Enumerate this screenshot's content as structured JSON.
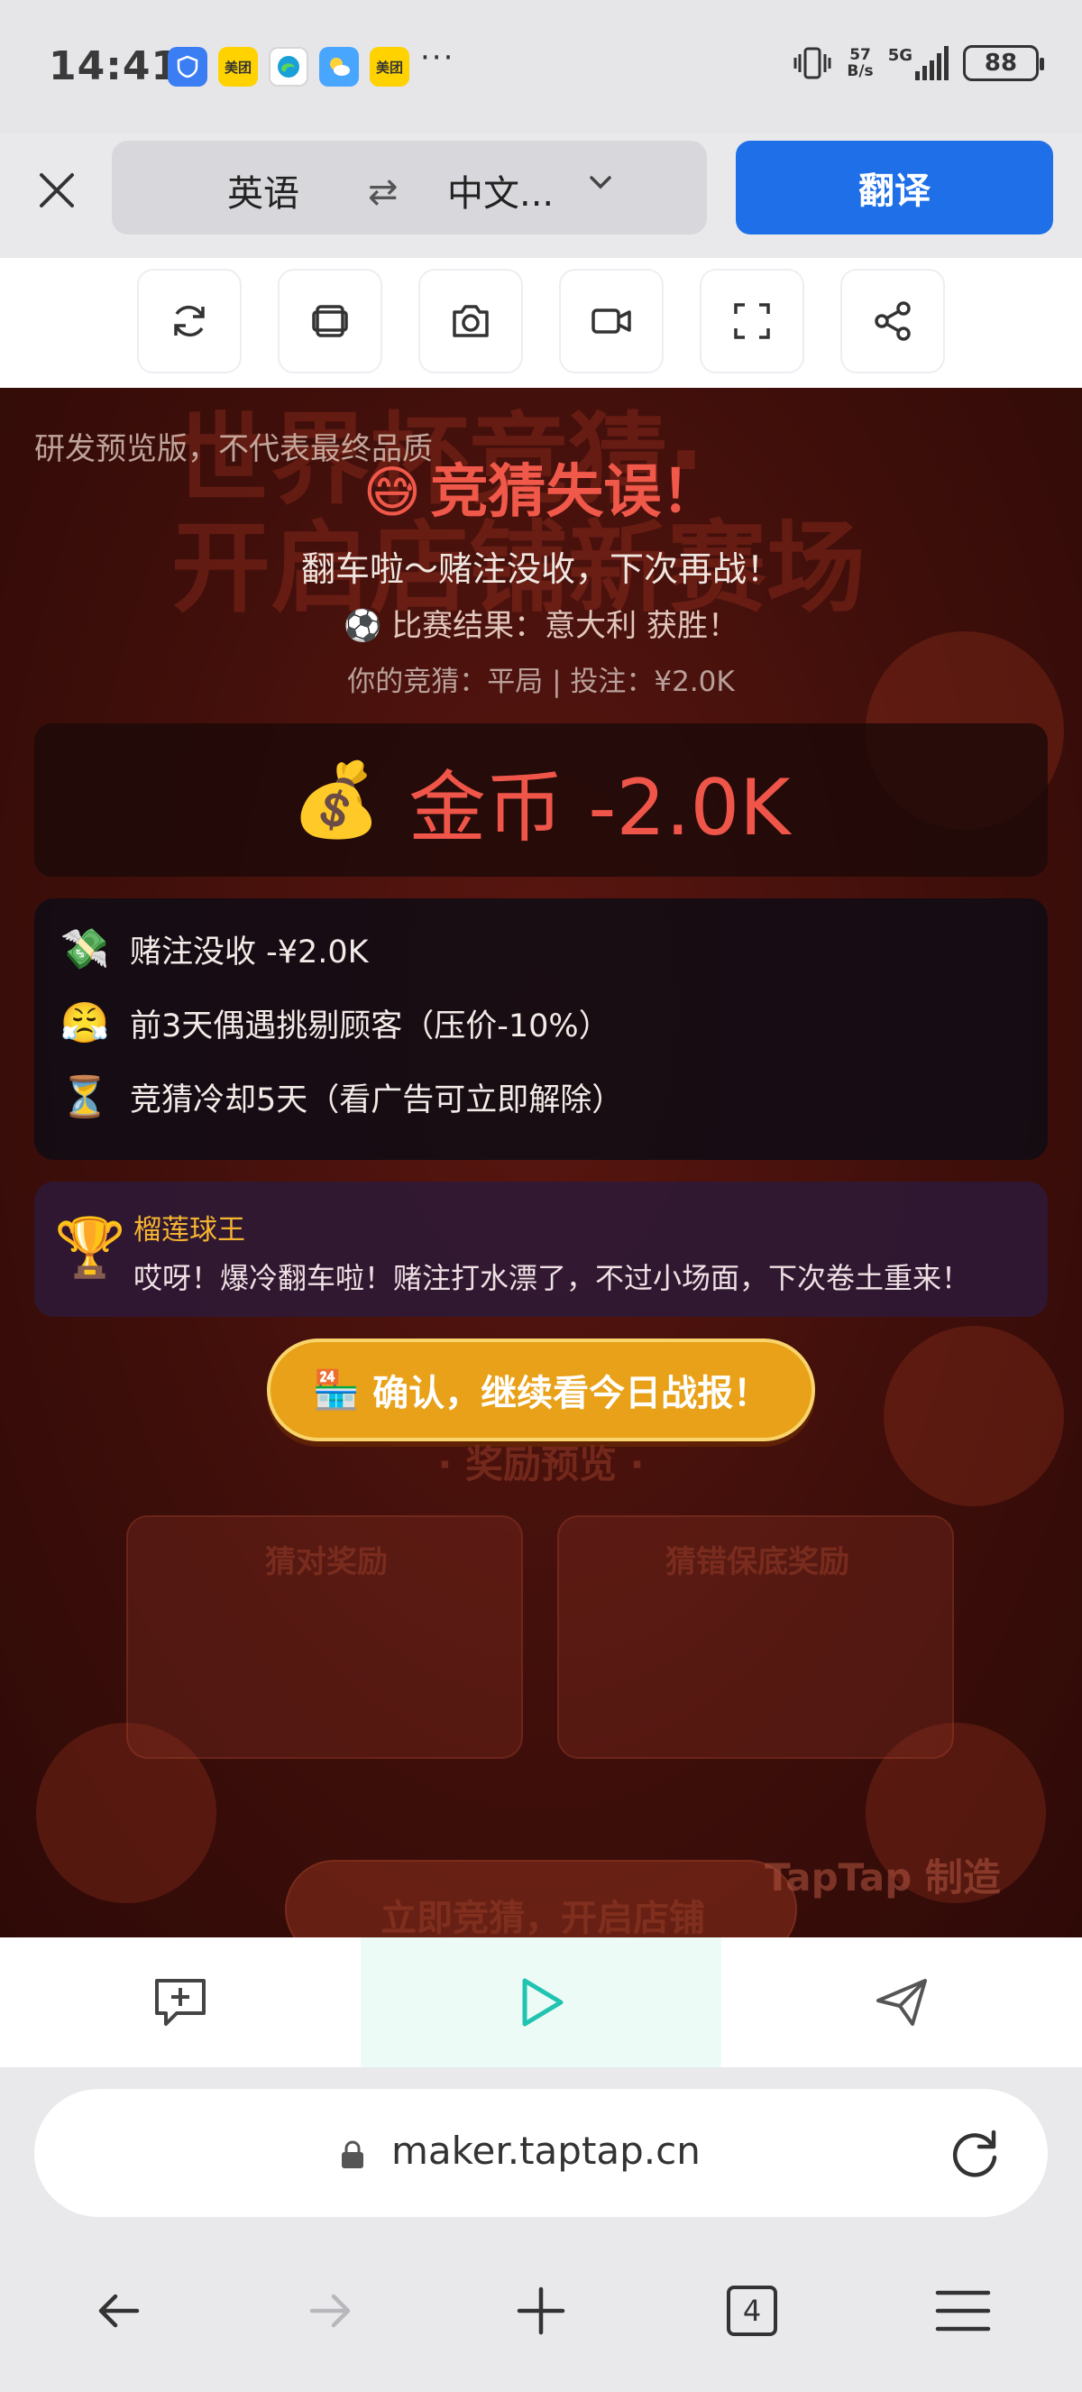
{
  "status_bar": {
    "time": "14:41",
    "apps": [
      {
        "name": "security-app-icon",
        "label": "",
        "style": "app-blue"
      },
      {
        "name": "meituan-app-icon",
        "label": "美团",
        "style": "app-yellow"
      },
      {
        "name": "edge-app-icon",
        "label": "",
        "style": "app-edge"
      },
      {
        "name": "weather-app-icon",
        "label": "",
        "style": "app-weather"
      },
      {
        "name": "meituan-app-icon-2",
        "label": "美团",
        "style": "app-yellow"
      }
    ],
    "more": "···",
    "net_speed_value": "57",
    "net_speed_unit": "B/s",
    "network": "5G",
    "battery": "88"
  },
  "translate_bar": {
    "source_lang": "英语",
    "swap_symbol": "⇄",
    "target_lang": "中文...",
    "translate_label": "翻译"
  },
  "toolbar": {
    "icons": [
      "refresh-icon",
      "copy-icon",
      "camera-icon",
      "video-icon",
      "fullscreen-icon",
      "share-icon"
    ]
  },
  "game": {
    "watermark": "研发预览版，不代表最终品质",
    "title_emoji": "😅",
    "title": "竞猜失误！",
    "subtitle": "翻车啦～赌注没收，下次再战！",
    "result_emoji": "⚽",
    "result": "比赛结果：意大利 获胜！",
    "guess": "你的竞猜：平局 | 投注：¥2.0K",
    "coin_emoji": "💰",
    "coin_change": "金币 -2.0K",
    "details": [
      {
        "emoji": "💸",
        "text": "赌注没收 -¥2.0K"
      },
      {
        "emoji": "😤",
        "text": "前3天偶遇挑剔顾客（压价-10%）"
      },
      {
        "emoji": "⏳",
        "text": "竞猜冷却5天（看广告可立即解除）"
      }
    ],
    "npc_emoji": "🏆",
    "npc_name": "榴莲球王",
    "npc_say": "哎呀！爆冷翻车啦！赌注打水漂了，不过小场面，下次卷土重来！",
    "confirm_emoji": "🏪",
    "confirm_label": "确认，继续看今日战报！",
    "bg_title_1": "世界杯竞猜·",
    "bg_title_2": "开启店铺新赛场",
    "bg_reward_title": "· 奖励预览 ·",
    "bg_card_1": "猜对奖励",
    "bg_card_2": "猜错保底奖励",
    "bg_button": "立即竞猜，开启店铺",
    "bg_brand": "TapTap 制造"
  },
  "browser": {
    "url": "maker.taptap.cn",
    "tab_count": "4"
  }
}
